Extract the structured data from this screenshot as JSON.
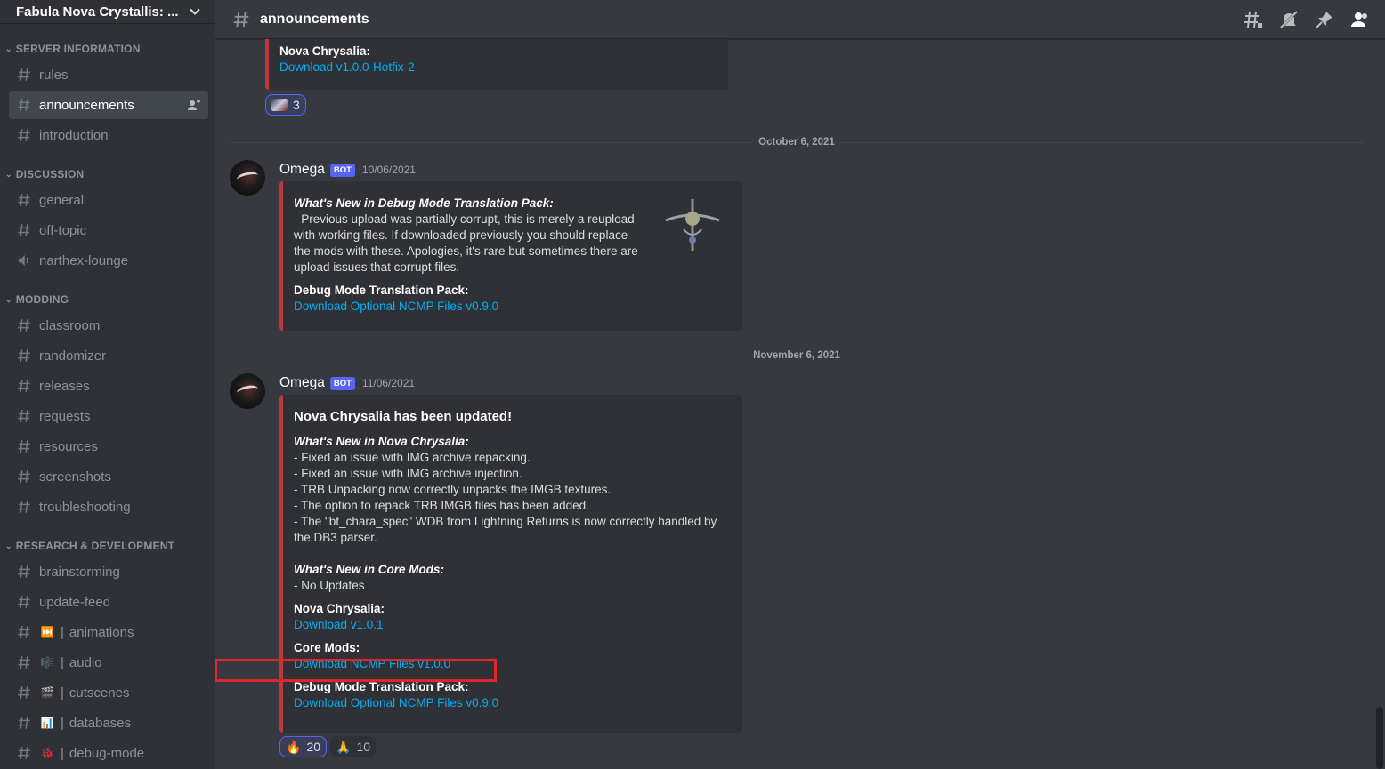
{
  "server": {
    "name": "Fabula Nova Crystallis: ..."
  },
  "categories": [
    {
      "name": "SERVER INFORMATION",
      "channels": [
        {
          "label": "rules"
        },
        {
          "label": "announcements"
        },
        {
          "label": "introduction"
        }
      ]
    },
    {
      "name": "DISCUSSION",
      "channels": [
        {
          "label": "general"
        },
        {
          "label": "off-topic"
        },
        {
          "label": "narthex-lounge"
        }
      ]
    },
    {
      "name": "MODDING",
      "channels": [
        {
          "label": "classroom"
        },
        {
          "label": "randomizer"
        },
        {
          "label": "releases"
        },
        {
          "label": "requests"
        },
        {
          "label": "resources"
        },
        {
          "label": "screenshots"
        },
        {
          "label": "troubleshooting"
        }
      ]
    },
    {
      "name": "RESEARCH & DEVELOPMENT",
      "channels": [
        {
          "label": "brainstorming"
        },
        {
          "label": "update-feed"
        },
        {
          "label": "animations",
          "emoji": "⏭️"
        },
        {
          "label": "audio",
          "emoji": "🎼"
        },
        {
          "label": "cutscenes",
          "emoji": "🎬"
        },
        {
          "label": "databases",
          "emoji": "📊"
        },
        {
          "label": "debug-mode",
          "emoji": "🐞"
        }
      ]
    }
  ],
  "topbar": {
    "channel": "announcements"
  },
  "msg0": {
    "field_name": "Nova Chrysalia:",
    "link": "Download v1.0.0-Hotfix-2",
    "reaction_count": "3"
  },
  "divider1": "October 6, 2021",
  "msg1": {
    "author": "Omega",
    "bot_tag": "BOT",
    "timestamp": "10/06/2021",
    "heading": "What's New in Debug Mode Translation Pack:",
    "body": "- Previous upload was partially corrupt, this is merely a reupload with working files. If downloaded previously you should replace the mods with these. Apologies, it's rare but sometimes there are upload issues that corrupt files.",
    "field_name": "Debug Mode Translation Pack:",
    "link": "Download Optional NCMP Files v0.9.0"
  },
  "divider2": "November 6, 2021",
  "msg2": {
    "author": "Omega",
    "bot_tag": "BOT",
    "timestamp": "11/06/2021",
    "title": "Nova Chrysalia has been updated!",
    "heading1": "What's New in Nova Chrysalia:",
    "items": [
      "- Fixed an issue with IMG archive repacking.",
      "- Fixed an issue with IMG archive injection.",
      "- TRB Unpacking now correctly unpacks the IMGB textures.",
      "- The option to repack TRB IMGB files has been added.",
      "- The \"bt_chara_spec\" WDB from Lightning Returns is now correctly handled by the DB3 parser."
    ],
    "heading2": "What's New in Core Mods:",
    "core_note": "- No Updates",
    "f1_name": "Nova Chrysalia:",
    "f1_link": "Download v1.0.1",
    "f2_name": "Core Mods:",
    "f2_link": "Download NCMP Files v1.0.0",
    "f3_name": "Debug Mode Translation Pack:",
    "f3_link": "Download Optional NCMP Files v0.9.0",
    "reactions": [
      {
        "emoji": "🔥",
        "count": "20"
      },
      {
        "emoji": "🙏",
        "count": "10"
      }
    ]
  }
}
